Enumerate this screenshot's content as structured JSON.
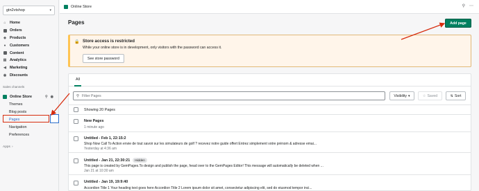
{
  "sidebar": {
    "store_name": "gtn2vtshop",
    "nav_items": [
      {
        "label": "Home",
        "icon": "home-icon"
      },
      {
        "label": "Orders",
        "icon": "orders-icon"
      },
      {
        "label": "Products",
        "icon": "products-icon"
      },
      {
        "label": "Customers",
        "icon": "customers-icon"
      },
      {
        "label": "Content",
        "icon": "content-icon"
      },
      {
        "label": "Analytics",
        "icon": "analytics-icon"
      },
      {
        "label": "Marketing",
        "icon": "marketing-icon"
      },
      {
        "label": "Discounts",
        "icon": "discounts-icon"
      }
    ],
    "sales_channels_label": "Sales channels",
    "online_store_label": "Online Store",
    "sub_items": [
      "Themes",
      "Blog posts",
      "Pages",
      "Navigation",
      "Preferences"
    ],
    "apps_label": "Apps"
  },
  "topbar": {
    "title": "Online Store"
  },
  "page": {
    "title": "Pages",
    "add_button": "Add page"
  },
  "banner": {
    "title": "Store access is restricted",
    "message": "While your online store is in development, only visitors with the password can access it.",
    "button": "See store password"
  },
  "card": {
    "tab_all": "All",
    "filter_placeholder": "Filter Pages",
    "visibility_label": "Visibility",
    "saved_label": "Saved",
    "sort_label": "Sort",
    "showing_label": "Showing 20 Pages",
    "rows": [
      {
        "title": "New Pages",
        "badge": "",
        "snippet": "",
        "time": "1 minute ago"
      },
      {
        "title": "Untitled - Feb 1, 22:15:2",
        "badge": "",
        "snippet": "Shop Now Call To Action envie de tout savoir sur les simulateurs de golf ? recevez notre guide offert Entrez simplement votre prénom & adresse emai...",
        "time": "Yesterday at 4:36 am"
      },
      {
        "title": "Untitled - Jan 21, 22:30:21",
        "badge": "Hidden",
        "snippet": "This page is created by GemPages.To design and publish the page, head over to the GemPages Editor! This message will automatically be deleted when ...",
        "time": "Jan 21 at 10:30 am"
      },
      {
        "title": "Untitled - Jan 19, 19:9:40",
        "badge": "",
        "snippet": "Accordion Title 1 Your heading text goes here Accordion Title 2 Lorem ipsum dolor sit amet, consectetur adipiscing elit, sed do eiusmod tempor inci...",
        "time": ""
      }
    ]
  },
  "colors": {
    "primary": "#008060",
    "annotation": "#d72c0d",
    "banner_bg": "#fff5ea"
  }
}
